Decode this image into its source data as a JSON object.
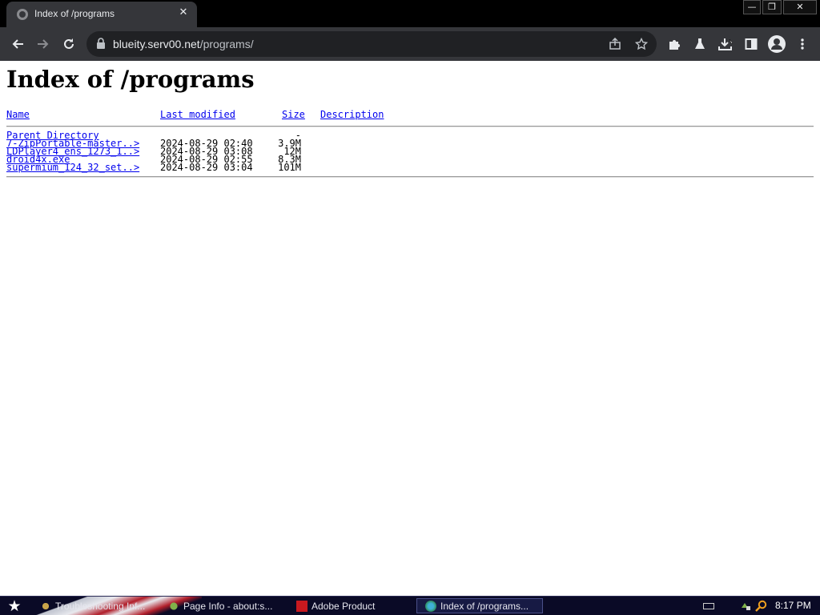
{
  "tab": {
    "title": "Index of /programs",
    "close": "✕"
  },
  "window_controls": {
    "minimize": "—",
    "maximize": "❐",
    "close": "✕"
  },
  "address_bar": {
    "host": "blueity.serv00.net",
    "path": "/programs/"
  },
  "page": {
    "heading": "Index of /programs",
    "columns": {
      "name": "Name",
      "last_modified": "Last modified",
      "size": "Size",
      "description": "Description"
    },
    "rows": [
      {
        "name": "Parent Directory",
        "modified": "",
        "size": "-",
        "description": ""
      },
      {
        "name": "7-ZipPortable-master..>",
        "modified": "2024-08-29 02:40",
        "size": "3.9M",
        "description": ""
      },
      {
        "name": "LDPlayer4_ens_1273_1..>",
        "modified": "2024-08-29 03:08",
        "size": "12M",
        "description": ""
      },
      {
        "name": "droid4x.exe",
        "modified": "2024-08-29 02:55",
        "size": "8.3M",
        "description": ""
      },
      {
        "name": "supermium_124_32_set..>",
        "modified": "2024-08-29 03:04",
        "size": "101M",
        "description": ""
      }
    ]
  },
  "taskbar": {
    "tasks": [
      {
        "label": "Troubleshooting Inf...",
        "icon": "tools-icon"
      },
      {
        "label": "Page Info - about:s...",
        "icon": "gear-icon"
      },
      {
        "label": "Adobe Product",
        "icon": "adobe-icon"
      },
      {
        "label": "Index of /programs...",
        "icon": "browser-icon",
        "active": true
      }
    ],
    "clock": "8:17 PM"
  }
}
